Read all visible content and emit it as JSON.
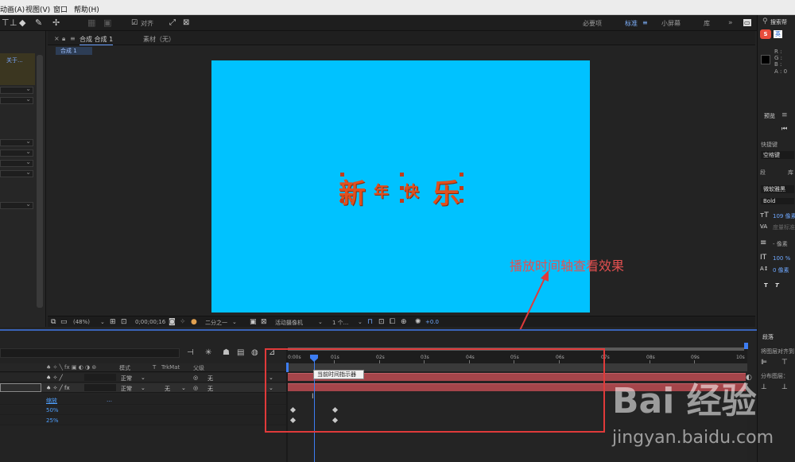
{
  "menubar": {
    "items": [
      "动画(A)",
      "视图(V)",
      "窗口",
      "帮助(H)"
    ]
  },
  "toolbar": {
    "align_label": "对齐",
    "workspaces": [
      "必要项",
      "标准",
      "小屏幕",
      "库"
    ],
    "active_workspace": "标准",
    "search_label": "搜索帮"
  },
  "left_panel": {
    "link_label": "关于..."
  },
  "composition": {
    "tab_label": "合成 合成 1",
    "footage_tab": "素材（无）",
    "breadcrumb": "合成 1",
    "text_chars": [
      "新",
      "年",
      "快",
      "乐"
    ],
    "canvas_color": "#00c2ff",
    "text_color": "#e0501e"
  },
  "viewer_bar": {
    "zoom": "(48%)",
    "timecode": "0;00;00;16",
    "resolution": "二分之一",
    "camera": "活动摄像机",
    "views": "1 个...",
    "exposure": "+0.0"
  },
  "annotation": {
    "text": "播放时间轴查看效果",
    "color": "#e55050"
  },
  "right_panel": {
    "ime_label": "英",
    "color_info": [
      "R :",
      "G :",
      "B :",
      "A : 0"
    ],
    "preview_title": "预览",
    "shortcut_label": "快捷键",
    "shortcut_value": "空格键",
    "char_title": "段",
    "font_name": "微软雅黑",
    "font_style": "Bold",
    "font_size": "109 像素",
    "tracking": "度量标准",
    "leading": "- 像素",
    "vscale": "100 %",
    "baseline": "0 像素",
    "para_title": "段落",
    "align_layers": "将图层对齐到",
    "distribute": "分布图层："
  },
  "timeline": {
    "columns": [
      "模式",
      "T",
      "TrkMat",
      "父级"
    ],
    "layers": [
      {
        "mode": "正常",
        "trkmat": "",
        "parent": "无"
      },
      {
        "mode": "正常",
        "trkmat": "无",
        "parent": "无"
      }
    ],
    "property_name": "缩放",
    "property_values": [
      "50%",
      "25%"
    ],
    "ticks": [
      "0:00s",
      "01s",
      "02s",
      "03s",
      "04s",
      "05s",
      "06s",
      "07s",
      "08s",
      "09s",
      "10s"
    ],
    "tooltip": "当前时间指示器"
  },
  "watermark": {
    "brand": "Bai 经验",
    "url": "jingyan.baidu.com"
  }
}
